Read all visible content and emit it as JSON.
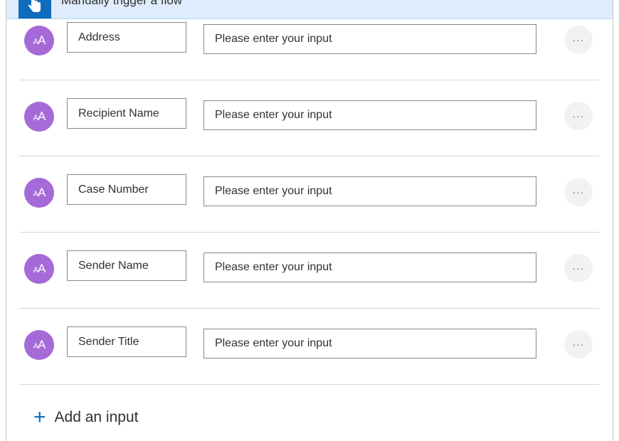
{
  "header": {
    "title": "Manually trigger a flow",
    "icon": "hand-pointer-icon"
  },
  "inputs": [
    {
      "name": "Address",
      "placeholder": "Please enter your input",
      "avatar_text_small": "A",
      "avatar_text_big": "A"
    },
    {
      "name": "Recipient Name",
      "placeholder": "Please enter your input",
      "avatar_text_small": "A",
      "avatar_text_big": "A"
    },
    {
      "name": "Case Number",
      "placeholder": "Please enter your input",
      "avatar_text_small": "A",
      "avatar_text_big": "A"
    },
    {
      "name": "Sender Name",
      "placeholder": "Please enter your input",
      "avatar_text_small": "A",
      "avatar_text_big": "A"
    },
    {
      "name": "Sender Title",
      "placeholder": "Please enter your input",
      "avatar_text_small": "A",
      "avatar_text_big": "A"
    }
  ],
  "more_label": "···",
  "add_input": {
    "icon": "+",
    "label": "Add an input"
  },
  "colors": {
    "accent": "#0f6cbd",
    "avatar": "#a56ad8",
    "header_bg": "#deecfd"
  }
}
